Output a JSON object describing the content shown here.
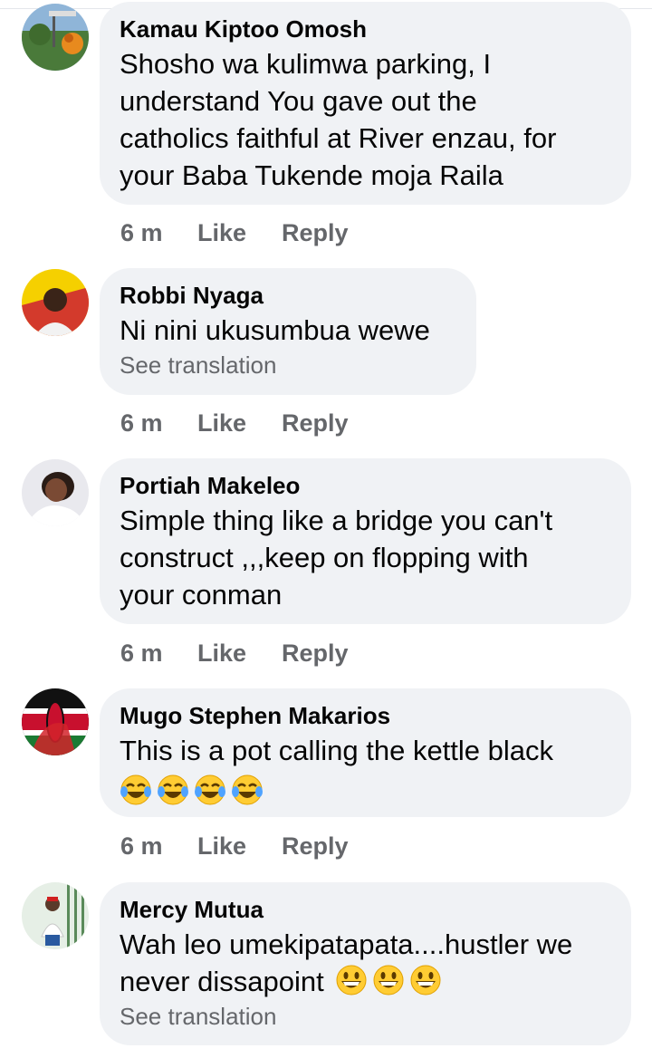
{
  "comments": [
    {
      "author": "Kamau Kiptoo Omosh",
      "lines": [
        "Shosho wa kulimwa parking, I",
        "understand You gave out the",
        "catholics faithful at River enzau, for",
        "your Baba Tukende moja Raila"
      ],
      "time": "6 m",
      "like": "Like",
      "reply": "Reply"
    },
    {
      "author": "Robbi Nyaga",
      "lines": [
        "Ni nini ukusumbua wewe"
      ],
      "see_translation": "See translation",
      "time": "6 m",
      "like": "Like",
      "reply": "Reply"
    },
    {
      "author": "Portiah Makeleo",
      "lines": [
        "Simple thing like a bridge you can't",
        "construct ,,,keep on flopping with",
        "your conman"
      ],
      "time": "6 m",
      "like": "Like",
      "reply": "Reply"
    },
    {
      "author": "Mugo Stephen Makarios",
      "lines": [
        "This is a pot calling the kettle black"
      ],
      "emoji_line": "tears-of-joy x4",
      "time": "6 m",
      "like": "Like",
      "reply": "Reply"
    },
    {
      "author": "Mercy Mutua",
      "lines": [
        "Wah leo umekipatapata....hustler we",
        "never dissapoint"
      ],
      "trailing_emoji": "grinning-face x3",
      "see_translation": "See translation"
    }
  ],
  "colors": {
    "bubble": "#f0f2f5",
    "meta_text": "#65676b",
    "text": "#050505"
  }
}
